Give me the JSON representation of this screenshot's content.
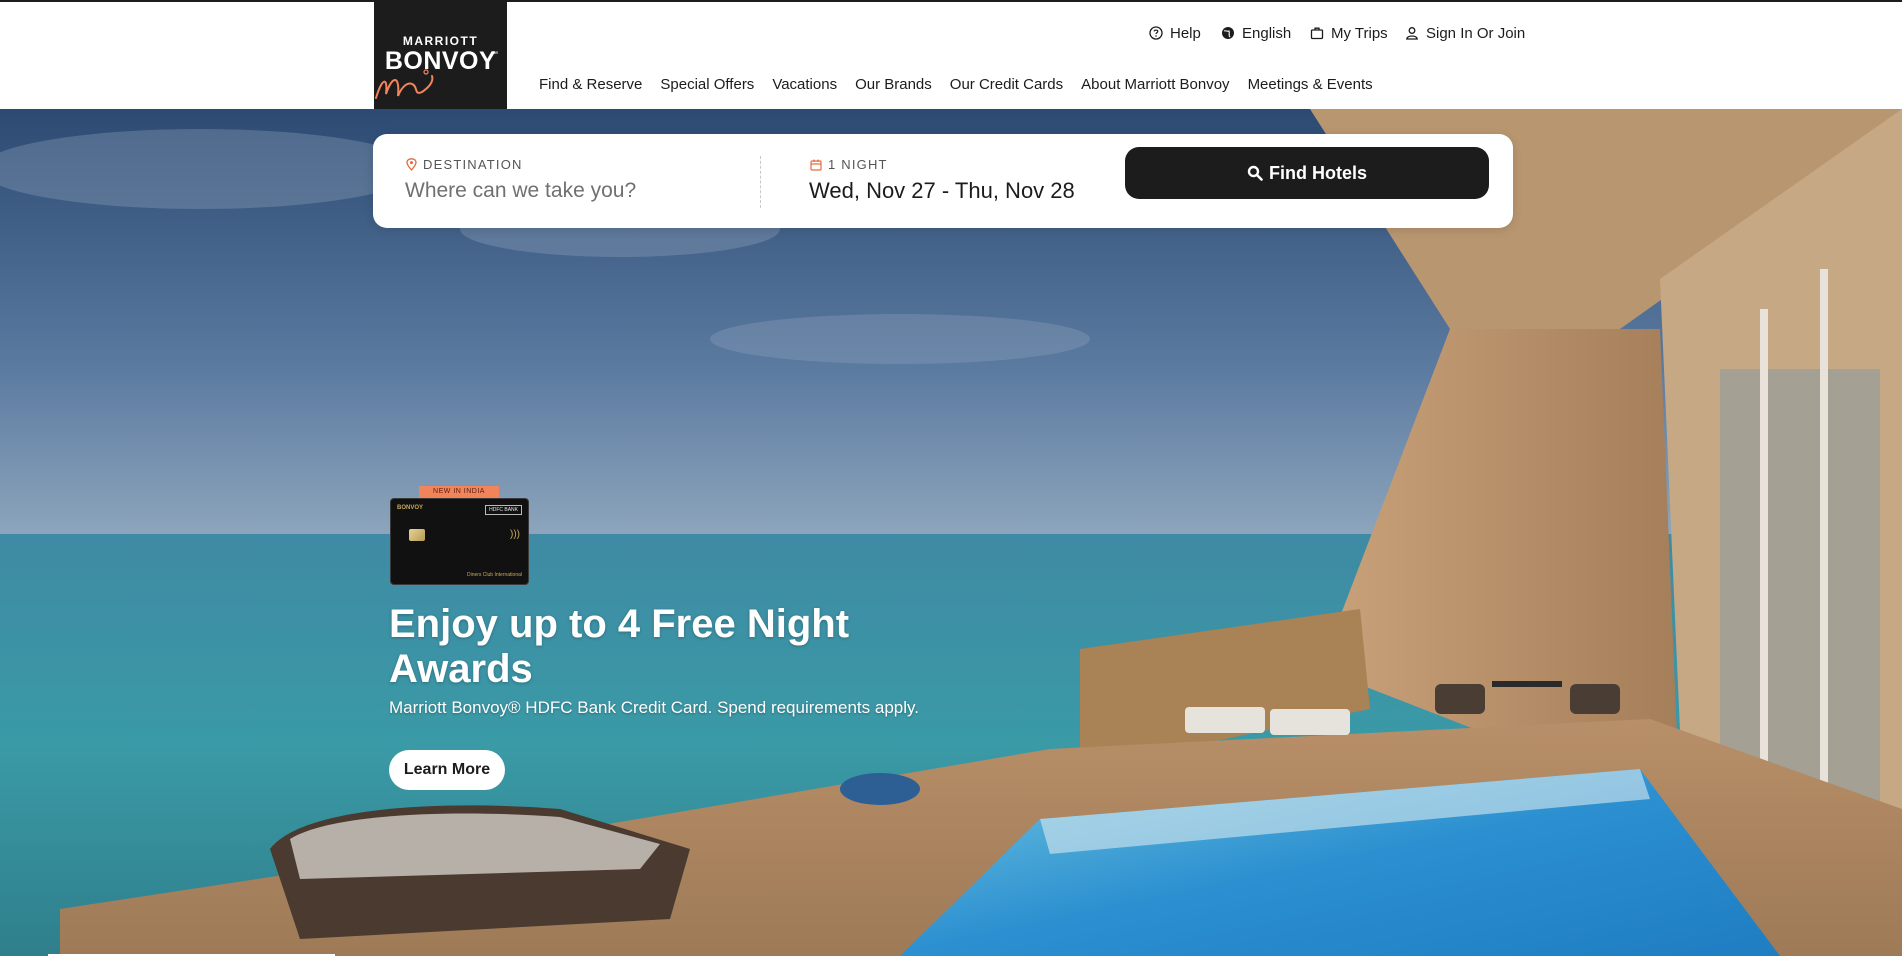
{
  "brand": {
    "logo_line1": "MARRIOTT",
    "logo_line2": "BONVOY",
    "logo_tm": "™"
  },
  "utility_nav": {
    "help": "Help",
    "language": "English",
    "trips": "My Trips",
    "sign_in": "Sign In Or Join"
  },
  "main_nav": [
    {
      "label": "Find & Reserve"
    },
    {
      "label": "Special Offers"
    },
    {
      "label": "Vacations"
    },
    {
      "label": "Our Brands"
    },
    {
      "label": "Our Credit Cards"
    },
    {
      "label": "About Marriott Bonvoy"
    },
    {
      "label": "Meetings & Events"
    }
  ],
  "search": {
    "destination_label": "DESTINATION",
    "destination_placeholder": "Where can we take you?",
    "nights_label": "1 NIGHT",
    "dates_value": "Wed, Nov 27 - Thu, Nov 28",
    "find_button": "Find Hotels"
  },
  "promo": {
    "badge": "NEW IN INDIA",
    "card_brand": "BONVOY",
    "card_bank": "HDFC BANK",
    "card_network": "Diners Club International",
    "title": "Enjoy up to 4 Free Night Awards",
    "subtitle": "Marriott Bonvoy® HDFC Bank Credit Card. Spend requirements apply.",
    "cta": "Learn More"
  },
  "icons": {
    "help": "help-circle-icon",
    "language": "globe-icon",
    "trips": "suitcase-icon",
    "sign_in": "person-icon",
    "destination": "location-pin-icon",
    "dates": "calendar-icon",
    "search": "search-icon"
  },
  "colors": {
    "accent_dark": "#1c1c1c",
    "badge": "#f2845c",
    "pin": "#e46a3d"
  }
}
